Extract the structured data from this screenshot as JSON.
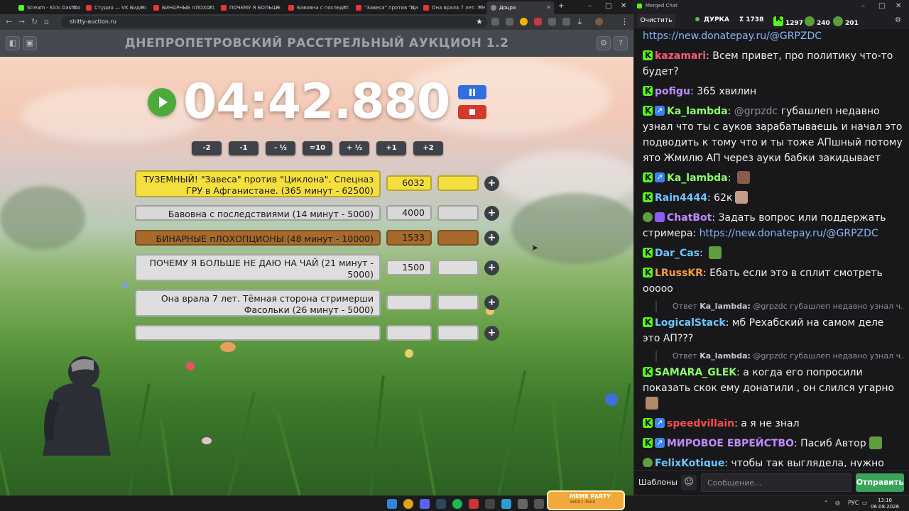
{
  "browser": {
    "tabs": [
      {
        "label": "Stream - Kick Dashbo...",
        "icon": "kick"
      },
      {
        "label": "Студия — VK Видео L...",
        "icon": "red"
      },
      {
        "label": "БИНАРНЫЕ пЛОХОП...",
        "icon": "red"
      },
      {
        "label": "ПОЧЕМУ Я БОЛЬШЕ ...",
        "icon": "red"
      },
      {
        "label": "Бавовна с последст...",
        "icon": "red"
      },
      {
        "label": "\"Завеса\" против \"Ци...",
        "icon": "red"
      },
      {
        "label": "Она врала 7 лет. Тём...",
        "icon": "red"
      },
      {
        "label": "Доцра",
        "icon": "gray",
        "active": true
      }
    ],
    "new_tab": "+",
    "url": "shitty-auction.ru"
  },
  "auction": {
    "title": "ДНЕПРОПЕТРОВСКИЙ РАССТРЕЛЬНЫЙ АУКЦИОН 1.2",
    "timer": "04:42.880",
    "steps": [
      "-2",
      "-1",
      "- ½",
      "=10",
      "+ ½",
      "+1",
      "+2"
    ],
    "lots": [
      {
        "name": "ТУЗЕМНЫЙ! \"Завеса\" против \"Циклона\". Спецназ ГРУ в Афганистане. (365 минут - 62500)",
        "amount": "6032",
        "color": "yellow"
      },
      {
        "name": "Бавовна с последствиями (14 минут - 5000)",
        "amount": "4000",
        "color": "gray"
      },
      {
        "name": "БИНАРНЫЕ пЛОХОПЦИОНЫ (48 минут - 10000)",
        "amount": "1533",
        "color": "brown"
      },
      {
        "name": "ПОЧЕМУ Я БОЛЬШЕ НЕ ДАЮ НА ЧАЙ (21 минут - 5000)",
        "amount": "1500",
        "color": "light"
      },
      {
        "name": "Она врала 7 лет. Тёмная сторона стримерши Фасольки (26 минут - 5000)",
        "amount": "",
        "color": "light"
      },
      {
        "name": "",
        "amount": "",
        "color": "light"
      }
    ],
    "plus": "+"
  },
  "chat": {
    "window_title": "Merged Chat",
    "clear": "Очистить",
    "stats": {
      "live": "ДУРКА",
      "sum": "Σ 1738",
      "kick": "1297",
      "other": "240",
      "pepe": "201"
    },
    "messages": [
      {
        "type": "text",
        "parts": [
          {
            "t": "link",
            "v": "https://new.donatepay.ru/@GRPZDC"
          }
        ]
      },
      {
        "user": "kazamari",
        "color": "#ff5a7a",
        "badges": [
          "kick"
        ],
        "text": "Всем привет, про политику что-то будет?"
      },
      {
        "user": "pofigu",
        "color": "#c08cff",
        "badges": [
          "kick"
        ],
        "text": "365 хвилин"
      },
      {
        "user": "Ka_lambda",
        "color": "#8cff6a",
        "badges": [
          "kick",
          "blue"
        ],
        "mention": "@grpzdc",
        "text": " губашлеп недавно узнал что ты с ауков зарабатываешь и начал это подводить к тому что и ты тоже АПшный потому ято Жмилю АП через ауки бабки закидывает"
      },
      {
        "user": "Ka_lambda",
        "color": "#8cff6a",
        "badges": [
          "kick",
          "blue"
        ],
        "text": "",
        "emote": "#8a5a4a"
      },
      {
        "user": "Rain4444",
        "color": "#6ec6ff",
        "badges": [
          "kick"
        ],
        "text": "62к",
        "emote": "#c49a8a"
      },
      {
        "user": "ChatBot",
        "color": "#c08cff",
        "badges": [
          "pepe",
          "purple"
        ],
        "text": "Задать вопрос или поддержать стримера: ",
        "link": "https://new.donatepay.ru/@GRPZDC"
      },
      {
        "user": "Dar_Cas",
        "color": "#6ec6ff",
        "badges": [
          "kick"
        ],
        "text": "",
        "emote": "#5e9e3d"
      },
      {
        "user": "LRussKR",
        "color": "#ff9a3c",
        "badges": [
          "kick"
        ],
        "text": "Ебать если это в сплит смотреть ооооо"
      },
      {
        "type": "reply",
        "prefix": "Ответ",
        "ruser": "Ka_lambda:",
        "mention": "@grpzdc",
        "text": " губашлеп недавно узнал ч..."
      },
      {
        "user": "LogicalStack",
        "color": "#6ec6ff",
        "badges": [
          "kick"
        ],
        "text": "мб Рехабский на самом деле это АП???"
      },
      {
        "type": "reply",
        "prefix": "Ответ",
        "ruser": "Ka_lambda:",
        "mention": "@grpzdc",
        "text": " губашлеп недавно узнал ч..."
      },
      {
        "user": "SAMARA_GLEK",
        "color": "#8cff6a",
        "badges": [
          "kick"
        ],
        "text": "а когда его попросили показать скок ему донатили , он слился угарно",
        "emote": "#b08a6a"
      },
      {
        "user": "speedvillain",
        "color": "#ff4d4d",
        "badges": [
          "kick",
          "blue"
        ],
        "text": "а я не знал"
      },
      {
        "user": "МИРОВОЕ ЕВРЕЙСТВО",
        "color": "#c08cff",
        "badges": [
          "kick",
          "blue"
        ],
        "text": "Пасиб Автор",
        "emote": "#5e9e3d"
      },
      {
        "user": "FelixKotique",
        "color": "#6ec6ff",
        "badges": [
          "pepe"
        ],
        "text": "чтобы так выглядела, нужно предварительно уничтожить полторашку.",
        "emote": "#c9b24a"
      }
    ],
    "templates": "Шаблоны",
    "input_placeholder": "Сообщение...",
    "send": "Отправить"
  },
  "taskbar": {
    "meme_party": "MEME PARTY",
    "meme_party_sub": "1600 / 3500",
    "lang": "РУС",
    "time": "13:16",
    "date": "06.08.2026"
  }
}
